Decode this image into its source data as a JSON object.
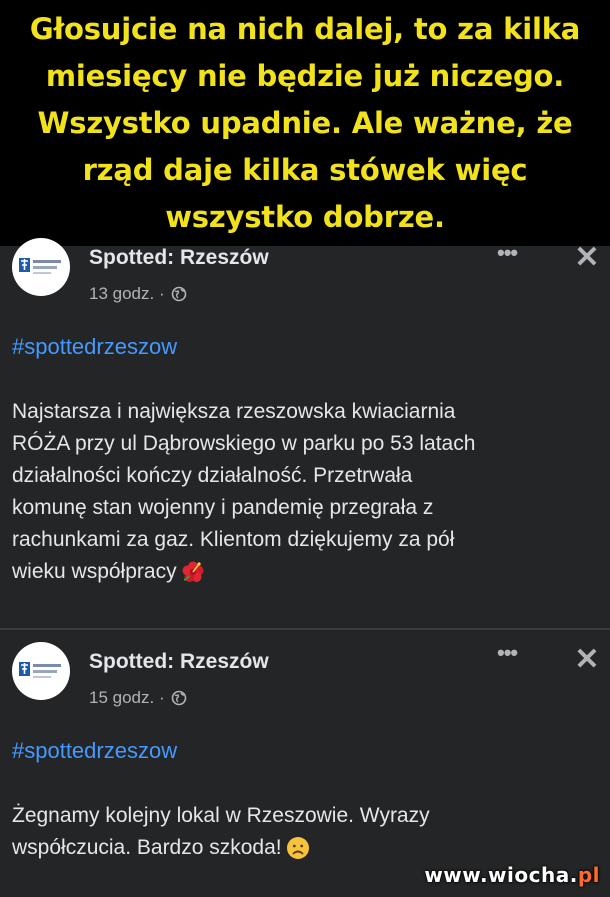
{
  "caption": {
    "text": "Głosujcie na nich dalej, to za kilka\nmiesięcy nie będzie już niczego.\nWszystko upadnie. Ale ważne, że\nrząd daje kilka stówek więc\nwszystko dobrze.",
    "color": "#f1e21b"
  },
  "posts": [
    {
      "page_name": "Spotted: Rzeszów",
      "time": "13 godz. ·",
      "privacy_icon": "globe-icon",
      "more_icon": "more-options-icon",
      "more_label": "•••",
      "close_label": "✕",
      "hashtag": "#spottedrzeszow",
      "body": "Najstarsza i największa rzeszowska kwiaciarnia\nRÓŻA przy ul Dąbrowskiego w parku po 53 latach\ndziałalności kończy działalność. Przetrwała\nkomunę stan wojenny i pandemię przegrała z\nrachunkami za gaz. Klientom dziękujemy za pół\nwieku współpracy",
      "emoji": "hibiscus-icon"
    },
    {
      "page_name": "Spotted: Rzeszów",
      "time": "15 godz. ·",
      "privacy_icon": "globe-icon",
      "more_icon": "more-options-icon",
      "more_label": "•••",
      "close_label": "✕",
      "hashtag": "#spottedrzeszow",
      "body": "Żegnamy kolejny lokal w Rzeszowie. Wyrazy\nwspółczucia. Bardzo szkoda!",
      "emoji": "frowning-face-icon"
    }
  ],
  "watermark": {
    "main": "www.wiocha.",
    "tld": "pl"
  },
  "colors": {
    "background": "#242526",
    "text": "#e4e6eb",
    "secondary": "#b0b3b8",
    "link": "#4599ff"
  }
}
